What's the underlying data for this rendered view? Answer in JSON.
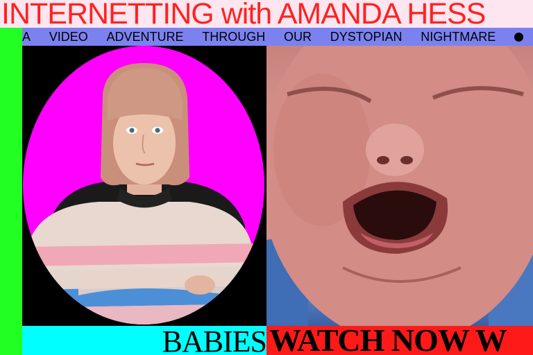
{
  "header": {
    "title": "INTERNETTING with AMANDA HESS"
  },
  "tagline": {
    "words": [
      "A",
      "VIDEO",
      "ADVENTURE",
      "THROUGH",
      "OUR",
      "DYSTOPIAN",
      "NIGHTMARE"
    ]
  },
  "footer": {
    "episode": "BABIES",
    "cta": "WATCH NOW W"
  },
  "colors": {
    "title_red": "#ff2222",
    "header_bg": "#fde6ef",
    "left_stripe": "#22ff22",
    "tagline_bg": "#7b82f0",
    "oval_magenta": "#ff00ff",
    "episode_bg": "#00ffff",
    "cta_bg": "#ff1a1a"
  }
}
